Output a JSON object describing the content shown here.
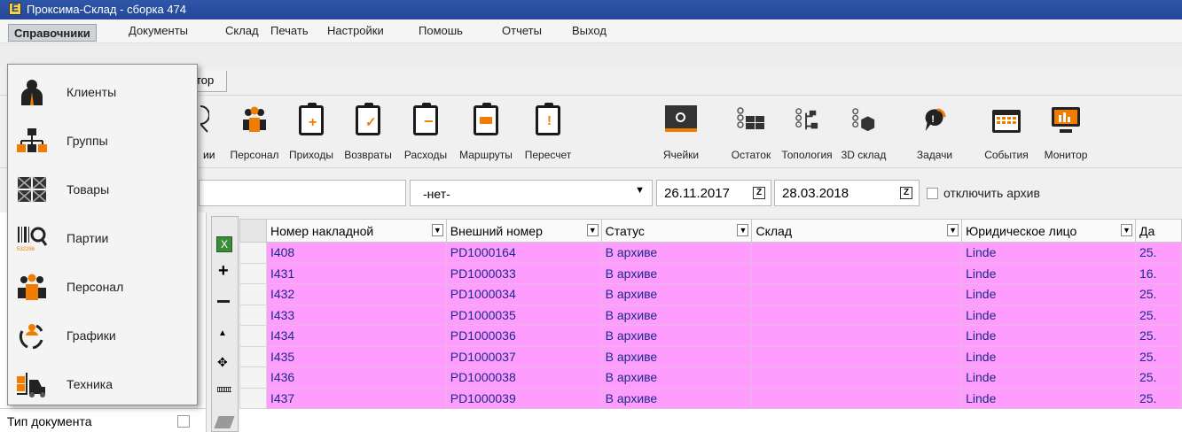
{
  "window": {
    "title": "Проксима-Склад - сборка 474"
  },
  "menubar": [
    "Справочники",
    "Документы",
    "Склад",
    "Печать",
    "Настройки",
    "Помошь",
    "Отчеты",
    "Выход"
  ],
  "tabs": {
    "partial_label": "тор"
  },
  "toolbar": {
    "partial_label": "ии",
    "items": [
      "Персонал",
      "Приходы",
      "Возвраты",
      "Расходы",
      "Маршруты",
      "Пересчет",
      "Ячейки",
      "Остаток",
      "Топология",
      "3D склад",
      "Задачи",
      "События",
      "Монитор"
    ]
  },
  "filters": {
    "select_value": "-нет-",
    "date_from": "26.11.2017",
    "date_to": "28.03.2018",
    "archive_checkbox_label": "отключить архив",
    "archive_checked": false
  },
  "side_panel": {
    "document_type_label": "Тип документа"
  },
  "dropdown_menu": {
    "items": [
      {
        "label": "Клиенты",
        "icon": "client-person-icon"
      },
      {
        "label": "Группы",
        "icon": "groups-hierarchy-icon"
      },
      {
        "label": "Товары",
        "icon": "goods-boxes-icon"
      },
      {
        "label": "Партии",
        "icon": "barcode-search-icon"
      },
      {
        "label": "Персонал",
        "icon": "staff-people-icon"
      },
      {
        "label": "Графики",
        "icon": "schedule-cycle-icon"
      },
      {
        "label": "Техника",
        "icon": "forklift-icon"
      }
    ]
  },
  "grid": {
    "columns": [
      "Номер накладной",
      "Внешний номер",
      "Статус",
      "Склад",
      "Юридическое лицо",
      "Да"
    ],
    "rows": [
      [
        "I408",
        "PD1000164",
        "В архиве",
        "",
        "Linde",
        "25."
      ],
      [
        "I431",
        "PD1000033",
        "В архиве",
        "",
        "Linde",
        "16."
      ],
      [
        "I432",
        "PD1000034",
        "В архиве",
        "",
        "Linde",
        "25."
      ],
      [
        "I433",
        "PD1000035",
        "В архиве",
        "",
        "Linde",
        "25."
      ],
      [
        "I434",
        "PD1000036",
        "В архиве",
        "",
        "Linde",
        "25."
      ],
      [
        "I435",
        "PD1000037",
        "В архиве",
        "",
        "Linde",
        "25."
      ],
      [
        "I436",
        "PD1000038",
        "В архиве",
        "",
        "Linde",
        "25."
      ],
      [
        "I437",
        "PD1000039",
        "В архиве",
        "",
        "Linde",
        "25."
      ]
    ],
    "row_color": "#ff9dff"
  },
  "colors": {
    "titlebar": "#2f56a8",
    "accent_orange": "#f07d00"
  }
}
